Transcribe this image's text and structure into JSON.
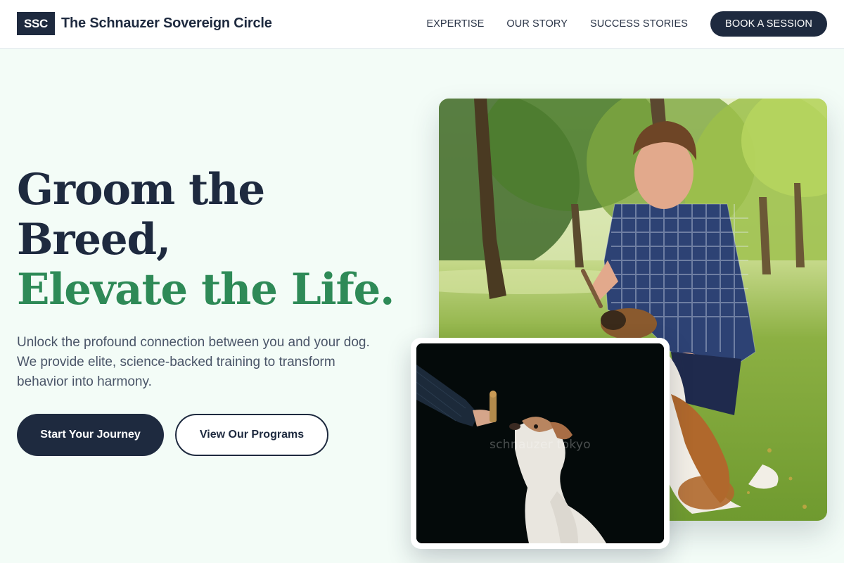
{
  "nav": {
    "brand_badge": "SSC",
    "brand_name": "The Schnauzer Sovereign Circle",
    "links": [
      "EXPERTISE",
      "OUR STORY",
      "SUCCESS STORIES"
    ],
    "cta": "BOOK A SESSION"
  },
  "hero": {
    "headline_line1": "Groom the",
    "headline_line2": "Breed,",
    "headline_line3": "Elevate the Life.",
    "subtext": "Unlock the profound connection between you and your dog. We provide elite, science-backed training to transform behavior into harmony.",
    "primary_button": "Start Your Journey",
    "secondary_button": "View Our Programs"
  },
  "images": {
    "inset_watermark": "schnauzer tokyo"
  },
  "colors": {
    "navy": "#1e2a3f",
    "accent_green": "#2e8a57",
    "page_background": "#f3fcf7"
  }
}
